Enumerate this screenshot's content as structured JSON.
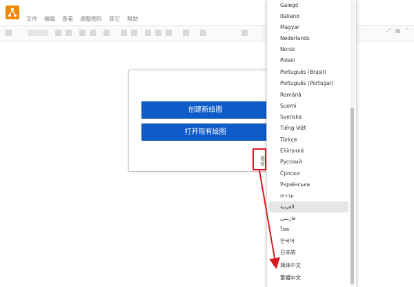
{
  "menubar": {
    "items": [
      "文件",
      "编辑",
      "查看",
      "调整图形",
      "其它",
      "帮助"
    ]
  },
  "dialog": {
    "create_label": "创建新绘图",
    "open_label": "打开现有绘图",
    "language_link": "语言"
  },
  "language_menu": {
    "items": [
      "Galego",
      "Italiano",
      "Magyar",
      "Nederlands",
      "Norsk",
      "Polski",
      "Português (Brasil)",
      "Português (Portugal)",
      "Română",
      "Suomi",
      "Svenska",
      "Tiếng Việt",
      "Türkçe",
      "Ελληνικά",
      "Русский",
      "Српски",
      "Українська",
      "עברית",
      "العربية",
      "فارسی",
      "ไทย",
      "한국어",
      "日本語",
      "简体中文",
      "繁體中文"
    ],
    "selected": "简体中文",
    "hovered": "العربية",
    "check_mark": "✓"
  },
  "colors": {
    "accent": "#0f5cc8",
    "annotation": "#d8181d",
    "logo": "#f08705"
  }
}
